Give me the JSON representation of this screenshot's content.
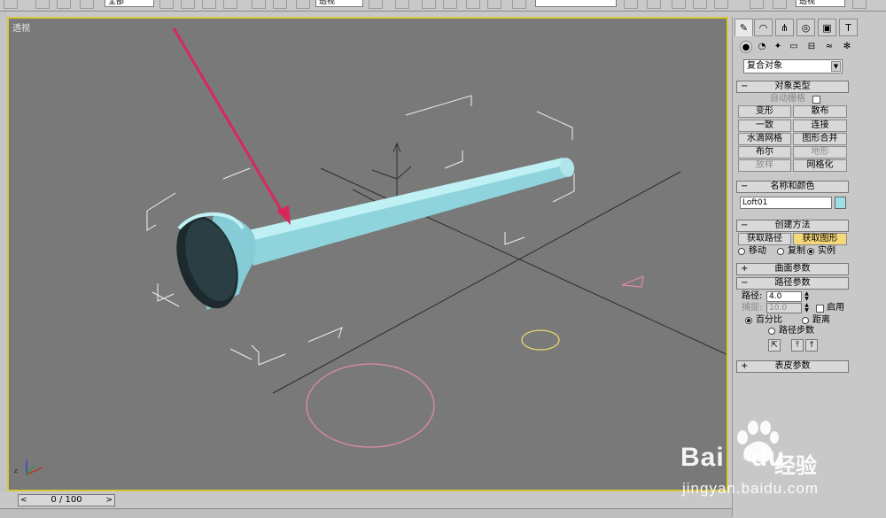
{
  "toolbar": {
    "view_dropdown": "透视",
    "named_sel": "全部"
  },
  "viewport": {
    "label": "透视",
    "accent": "#d8c83a"
  },
  "timebar": {
    "value": "0 / 100",
    "prev": "<",
    "next": ">"
  },
  "command_panel": {
    "tabs": [
      "create",
      "modify",
      "hierarchy",
      "motion",
      "display",
      "utilities"
    ],
    "categories": [
      "geometry",
      "shapes",
      "lights",
      "cameras",
      "helpers",
      "spacewarps",
      "systems"
    ],
    "category_dropdown": "复合对象",
    "object_type": {
      "title": "对象类型",
      "autogrid": "自动栅格",
      "buttons": [
        "变形",
        "散布",
        "一致",
        "连接",
        "水滴网格",
        "图形合并",
        "布尔",
        "地形",
        "放样",
        "网格化"
      ]
    },
    "name_color": {
      "title": "名称和颜色",
      "name": "Loft01",
      "color": "#9ee0e6"
    },
    "creation_method": {
      "title": "创建方法",
      "get_path": "获取路径",
      "get_shape": "获取图形",
      "move": "移动",
      "copy": "复制",
      "instance": "实例"
    },
    "surface_params": {
      "title": "曲面参数"
    },
    "path_params": {
      "title": "路径参数",
      "path_label": "路径:",
      "path_value": "4.0",
      "snap_label": "捕捉:",
      "snap_value": "10.0",
      "enable": "启用",
      "percent": "百分比",
      "distance": "距离",
      "path_steps": "路径步数"
    },
    "skin_params": {
      "title": "表皮参数"
    }
  },
  "watermark": {
    "logo": "Bai",
    "logo2": "du",
    "jingyan": "经验",
    "url": "jingyan.baidu.com"
  }
}
